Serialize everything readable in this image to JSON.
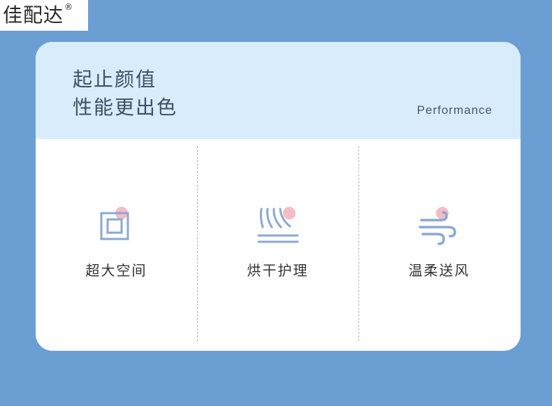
{
  "brand": {
    "name": "佳配达",
    "registered_mark": "®"
  },
  "header": {
    "title_line1": "起止颜值",
    "title_line2": "性能更出色",
    "subtitle_en": "Performance"
  },
  "features": [
    {
      "label": "超大空间",
      "icon": "square-space-icon"
    },
    {
      "label": "烘干护理",
      "icon": "heat-dry-icon"
    },
    {
      "label": "温柔送风",
      "icon": "wind-icon"
    }
  ],
  "colors": {
    "page_background": "#6b9fd4",
    "header_background": "#d8ecfc",
    "card_background": "#ffffff",
    "icon_blue": "#8aa8d2",
    "icon_pink_dot": "#f6bcc6",
    "title_text": "#3d4f66"
  }
}
